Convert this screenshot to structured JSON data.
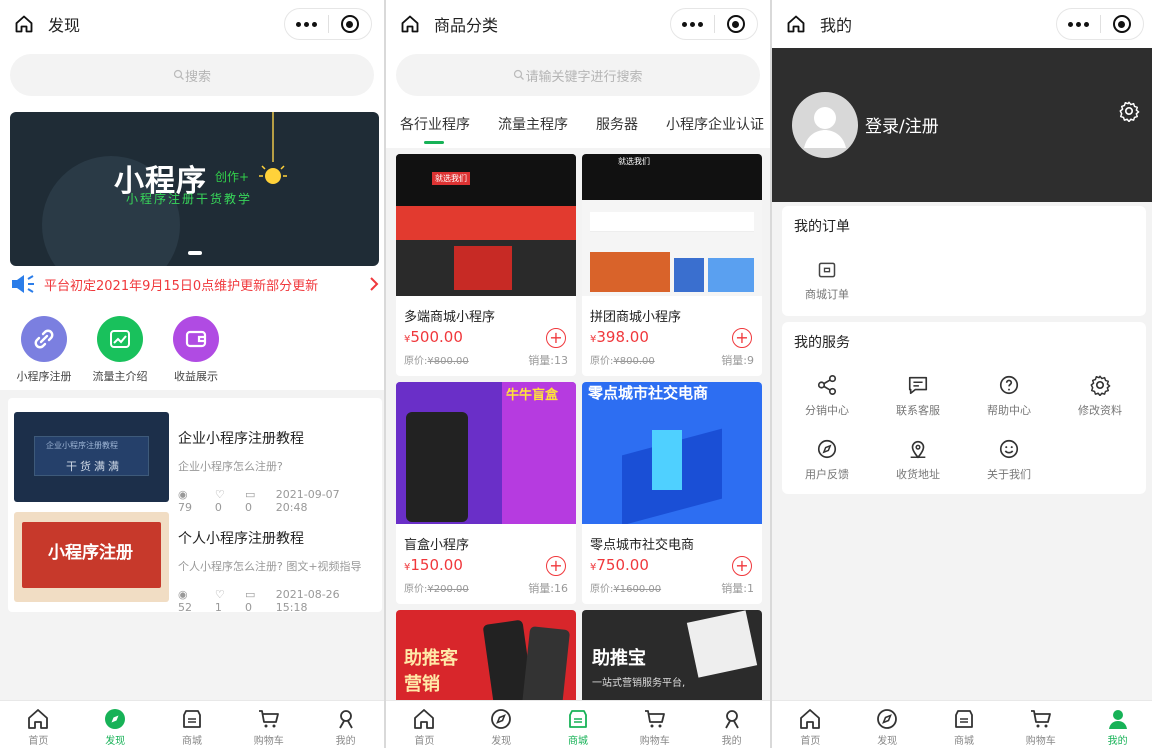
{
  "screens": [
    {
      "title": "发现",
      "search_placeholder": "搜索",
      "banner": {
        "title": "小程序",
        "tag": "创作+",
        "subtitle": "小程序注册干货教学"
      },
      "notice": "平台初定2021年9月15日0点维护更新部分更新",
      "quick_links": [
        {
          "label": "小程序注册",
          "color": "#7b7fe0"
        },
        {
          "label": "流量主介绍",
          "color": "#19c15c"
        },
        {
          "label": "收益展示",
          "color": "#b04be3"
        }
      ],
      "articles": [
        {
          "title": "企业小程序注册教程",
          "subtitle": "企业小程序怎么注册?",
          "views": "79",
          "likes": "0",
          "comments": "0",
          "date": "2021-09-07 20:48",
          "thumb_text": "干货满满",
          "thumb_small": "企业小程序注册教程"
        },
        {
          "title": "个人小程序注册教程",
          "subtitle": "个人小程序怎么注册? 图文+视频指导",
          "views": "52",
          "likes": "1",
          "comments": "0",
          "date": "2021-08-26 15:18",
          "thumb_text": "小程序注册"
        }
      ]
    },
    {
      "title": "商品分类",
      "search_placeholder": "请输关键字进行搜索",
      "categories": [
        "各行业程序",
        "流量主程序",
        "服务器",
        "小程序企业认证"
      ],
      "products": [
        {
          "name": "多端商城小程序",
          "price": "500.00",
          "old_price": "¥800.00",
          "sold": "销量:13",
          "img_text": "就选我们"
        },
        {
          "name": "拼团商城小程序",
          "price": "398.00",
          "old_price": "¥800.00",
          "sold": "销量:9",
          "img_text": "就选我们"
        },
        {
          "name": "盲盒小程序",
          "price": "150.00",
          "old_price": "¥200.00",
          "sold": "销量:16",
          "img_text": "牛牛盲盒"
        },
        {
          "name": "零点城市社交电商",
          "price": "750.00",
          "old_price": "¥1600.00",
          "sold": "销量:1",
          "img_text": "零点城市社交电商"
        },
        {
          "name": "",
          "img_text": "助推客营销"
        },
        {
          "name": "",
          "img_text": "助推宝",
          "img_sub": "一站式营销服务平台,"
        }
      ],
      "currency": "¥"
    },
    {
      "title": "我的",
      "login_text": "登录/注册",
      "orders_title": "我的订单",
      "orders": [
        {
          "label": "商城订单",
          "icon": "wallet-icon"
        }
      ],
      "services_title": "我的服务",
      "services": [
        {
          "label": "分销中心",
          "icon": "share-icon"
        },
        {
          "label": "联系客服",
          "icon": "message-icon"
        },
        {
          "label": "帮助中心",
          "icon": "question-icon"
        },
        {
          "label": "修改资料",
          "icon": "gear-icon"
        },
        {
          "label": "用户反馈",
          "icon": "compass-icon"
        },
        {
          "label": "收货地址",
          "icon": "location-icon"
        },
        {
          "label": "关于我们",
          "icon": "smile-icon"
        }
      ]
    }
  ],
  "tabbars": [
    {
      "active": 1,
      "tabs": [
        "首页",
        "发现",
        "商城",
        "购物车",
        "我的"
      ]
    },
    {
      "active": 2,
      "tabs": [
        "首页",
        "发现",
        "商城",
        "购物车",
        "我的"
      ]
    },
    {
      "active": 4,
      "tabs": [
        "首页",
        "发现",
        "商城",
        "购物车",
        "我的"
      ]
    }
  ],
  "colors": {
    "accent": "#17b257",
    "price": "#f0383c"
  }
}
